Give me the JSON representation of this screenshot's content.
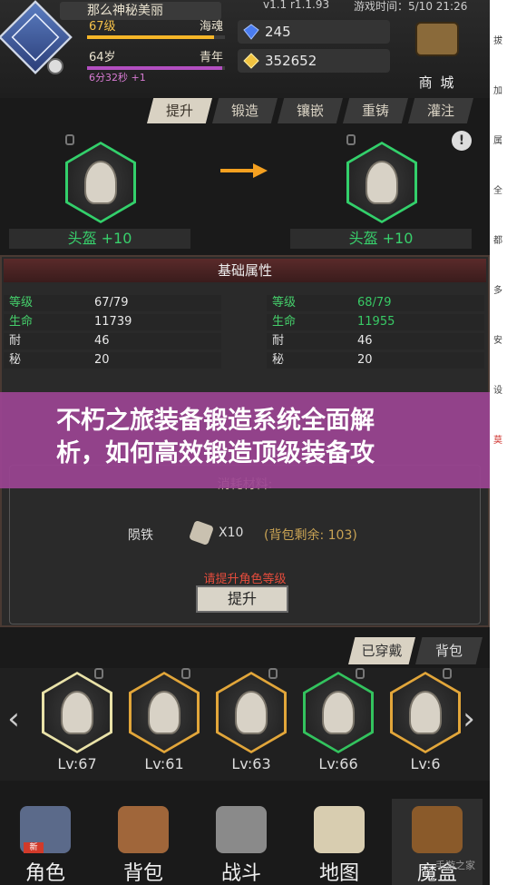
{
  "header": {
    "player_name": "那么神秘美丽",
    "level_label": "67级",
    "realm_label": "海魂",
    "age_label": "64岁",
    "age_stage": "青年",
    "timer": "6分32秒 +1",
    "version": "v1.1 r1.1.93",
    "clock": "游戏时间：5/10 21:26",
    "gems": "245",
    "gold": "352652",
    "shop_label": "商 城",
    "level_progress": 0.92,
    "age_progress": 0.98,
    "colors": {
      "level_bar": "#f6b628",
      "age_bar": "#b34fc1"
    }
  },
  "tabs": [
    "提升",
    "锻造",
    "镶嵌",
    "重铸",
    "灌注"
  ],
  "active_tab": 0,
  "compare": {
    "left_label": "头盔 +10",
    "right_label": "头盔 +10",
    "warning_glyph": "!"
  },
  "attributes": {
    "title": "基础属性",
    "left": [
      {
        "k": "等级",
        "v": "67/79"
      },
      {
        "k": "生命",
        "v": "11739"
      },
      {
        "k": "耐",
        "v": "46"
      },
      {
        "k": "秘",
        "v": "20"
      }
    ],
    "right": [
      {
        "k": "等级",
        "v": "68/79"
      },
      {
        "k": "生命",
        "v": "11955"
      },
      {
        "k": "耐",
        "v": "46"
      },
      {
        "k": "秘",
        "v": "20"
      }
    ]
  },
  "overlay": {
    "line1": "不朽之旅装备锻造系统全面解",
    "line2": "析，如何高效锻造顶级装备攻"
  },
  "consume": {
    "title": "消耗材料:",
    "material": "陨铁",
    "count": "X10",
    "remain": "(背包剩余: 103)",
    "warning": "请提升角色等级",
    "button": "提升"
  },
  "equip_tabs": [
    "已穿戴",
    "背包"
  ],
  "equipment": [
    {
      "name": "helmet-icon",
      "lv": "Lv:67",
      "border": "#e9e2a8"
    },
    {
      "name": "armor-icon",
      "lv": "Lv:61",
      "border": "#e2a63a"
    },
    {
      "name": "bracer-icon",
      "lv": "Lv:63",
      "border": "#e2a63a"
    },
    {
      "name": "boots-icon",
      "lv": "Lv:66",
      "border": "#33c35e"
    },
    {
      "name": "ring-icon",
      "lv": "Lv:6",
      "border": "#e2a63a"
    }
  ],
  "bottom_nav": [
    {
      "label": "角色",
      "color": "#5b6a8a",
      "badge": "新"
    },
    {
      "label": "背包",
      "color": "#a0663a"
    },
    {
      "label": "战斗",
      "color": "#8a8a8a"
    },
    {
      "label": "地图",
      "color": "#d8cdb0"
    },
    {
      "label": "魔盒",
      "color": "#8a5a2a"
    }
  ],
  "watermark": "手游之家",
  "system_strip": [
    "拔",
    "加",
    "属",
    "全",
    "都",
    "多",
    "安",
    "设",
    "莫"
  ]
}
